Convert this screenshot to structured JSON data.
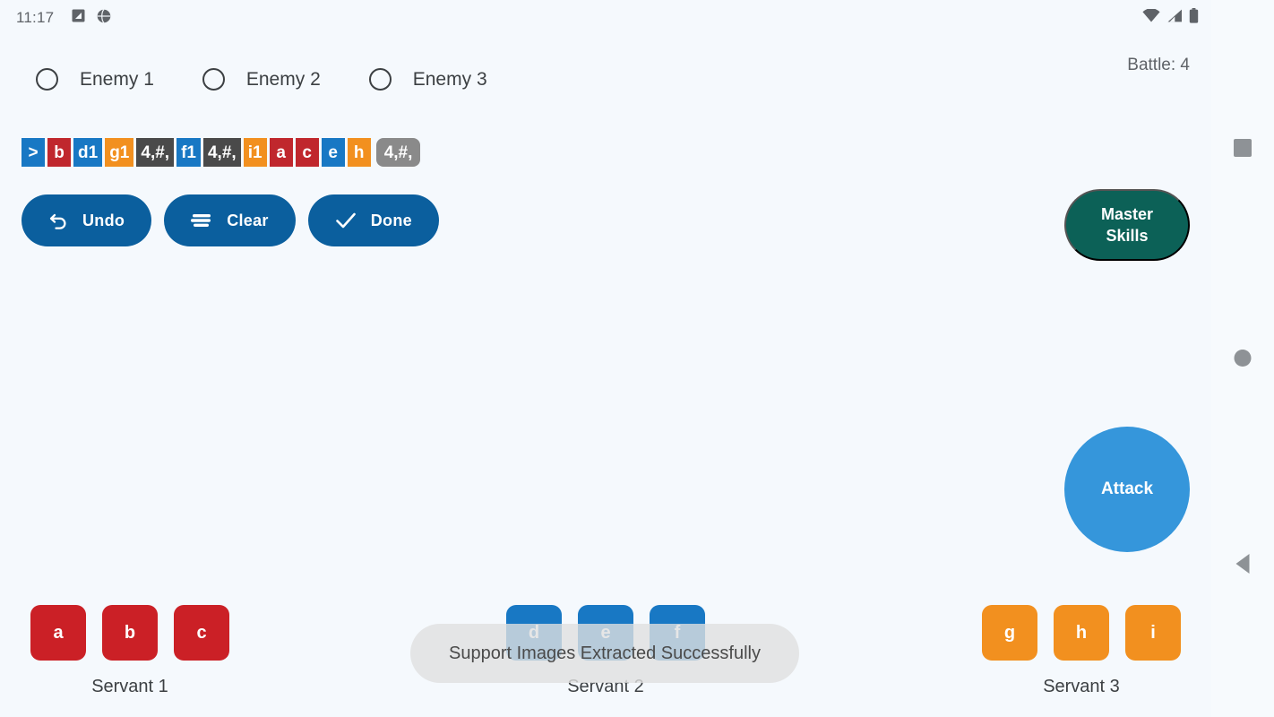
{
  "status_bar": {
    "time": "11:17",
    "left_icons": [
      "screenshot-icon",
      "globe-icon"
    ],
    "right_icons": [
      "wifi-icon",
      "cellular-signal-icon",
      "battery-icon"
    ]
  },
  "nav_rail": {
    "recents_label": "recents-square",
    "home_label": "home-circle",
    "back_label": "back-triangle"
  },
  "enemy_selector": {
    "items": [
      {
        "label": "Enemy 1",
        "selected": false
      },
      {
        "label": "Enemy 2",
        "selected": false
      },
      {
        "label": "Enemy 3",
        "selected": false
      }
    ]
  },
  "battle": {
    "counter_text": "Battle: 4"
  },
  "command_tokens": [
    {
      "text": ">",
      "color_class": "c-blue",
      "color": "#1878c4",
      "selected": false
    },
    {
      "text": "b",
      "color_class": "c-red",
      "color": "#c0272d",
      "selected": false
    },
    {
      "text": "d1",
      "color_class": "c-blue",
      "color": "#1878c4",
      "selected": false
    },
    {
      "text": "g1",
      "color_class": "c-orange",
      "color": "#f2901f",
      "selected": false
    },
    {
      "text": "4,#,",
      "color_class": "c-gray",
      "color": "#4a4a4a",
      "selected": false
    },
    {
      "text": "f1",
      "color_class": "c-blue",
      "color": "#1878c4",
      "selected": false
    },
    {
      "text": "4,#,",
      "color_class": "c-gray",
      "color": "#4a4a4a",
      "selected": false
    },
    {
      "text": "i1",
      "color_class": "c-orange",
      "color": "#f2901f",
      "selected": false
    },
    {
      "text": "a",
      "color_class": "c-red",
      "color": "#c0272d",
      "selected": false
    },
    {
      "text": "c",
      "color_class": "c-red",
      "color": "#c0272d",
      "selected": false
    },
    {
      "text": "e",
      "color_class": "c-blue",
      "color": "#1878c4",
      "selected": false
    },
    {
      "text": "h",
      "color_class": "c-orange",
      "color": "#f2901f",
      "selected": false
    },
    {
      "text": "4,#,",
      "color_class": "c-gray",
      "color": "#8a8a8a",
      "selected": true
    }
  ],
  "actions": {
    "undo_label": "Undo",
    "clear_label": "Clear",
    "done_label": "Done",
    "button_color": "#0b5f9e"
  },
  "master_skills": {
    "line1": "Master",
    "line2": "Skills",
    "color": "#0c6157"
  },
  "attack": {
    "label": "Attack",
    "color": "#3596db"
  },
  "servants": [
    {
      "name": "Servant 1",
      "color": "#cb2026",
      "color_class": "red",
      "cards": [
        "a",
        "b",
        "c"
      ]
    },
    {
      "name": "Servant 2",
      "color": "#1878c4",
      "color_class": "blue",
      "cards": [
        "d",
        "e",
        "f"
      ]
    },
    {
      "name": "Servant 3",
      "color": "#f2901f",
      "color_class": "orange",
      "cards": [
        "g",
        "h",
        "i"
      ]
    }
  ],
  "toast": {
    "message": "Support Images Extracted Successfully"
  },
  "theme": {
    "background": "#f5f9fd",
    "text": "#3c4043"
  }
}
